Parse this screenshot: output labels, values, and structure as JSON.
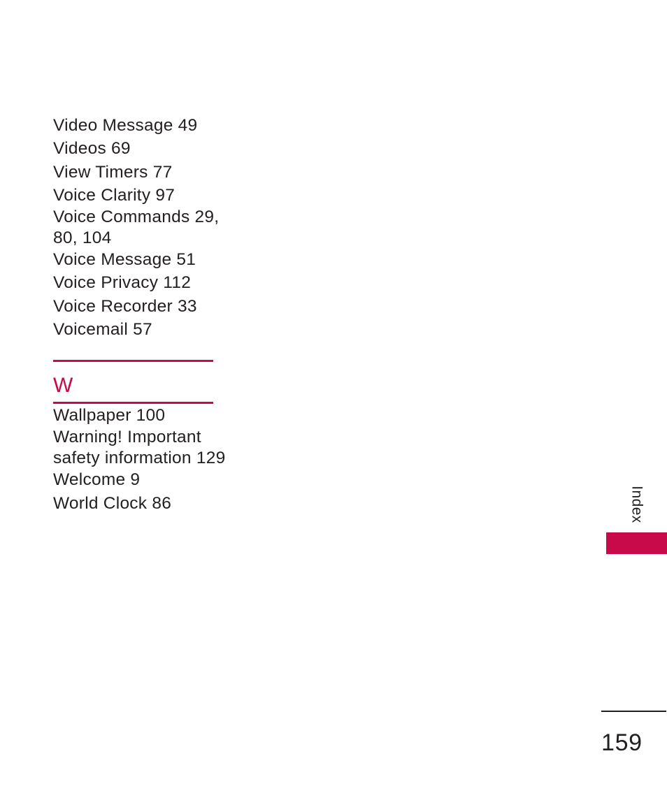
{
  "document": {
    "type": "index",
    "page_number": "159",
    "side_tab_label": "Index"
  },
  "colors": {
    "accent": "#c80a4b",
    "text": "#231f20",
    "background": "#ffffff"
  },
  "sections": [
    {
      "heading": "",
      "entries": [
        {
          "text": "Video Message 49",
          "wrapped": false
        },
        {
          "text": "Videos 69",
          "wrapped": false
        },
        {
          "text": "View Timers 77",
          "wrapped": false
        },
        {
          "text": "Voice Clarity 97",
          "wrapped": false
        },
        {
          "text": "Voice Commands 29,\n80, 104",
          "wrapped": true
        },
        {
          "text": "Voice Message 51",
          "wrapped": false
        },
        {
          "text": "Voice Privacy 112",
          "wrapped": false
        },
        {
          "text": "Voice Recorder 33",
          "wrapped": false
        },
        {
          "text": "Voicemail 57",
          "wrapped": false
        }
      ]
    },
    {
      "heading": "W",
      "entries": [
        {
          "text": "Wallpaper 100",
          "wrapped": false
        },
        {
          "text": "Warning! Important\nsafety information 129",
          "wrapped": true
        },
        {
          "text": "Welcome 9",
          "wrapped": false
        },
        {
          "text": "World Clock 86",
          "wrapped": false
        }
      ]
    }
  ]
}
